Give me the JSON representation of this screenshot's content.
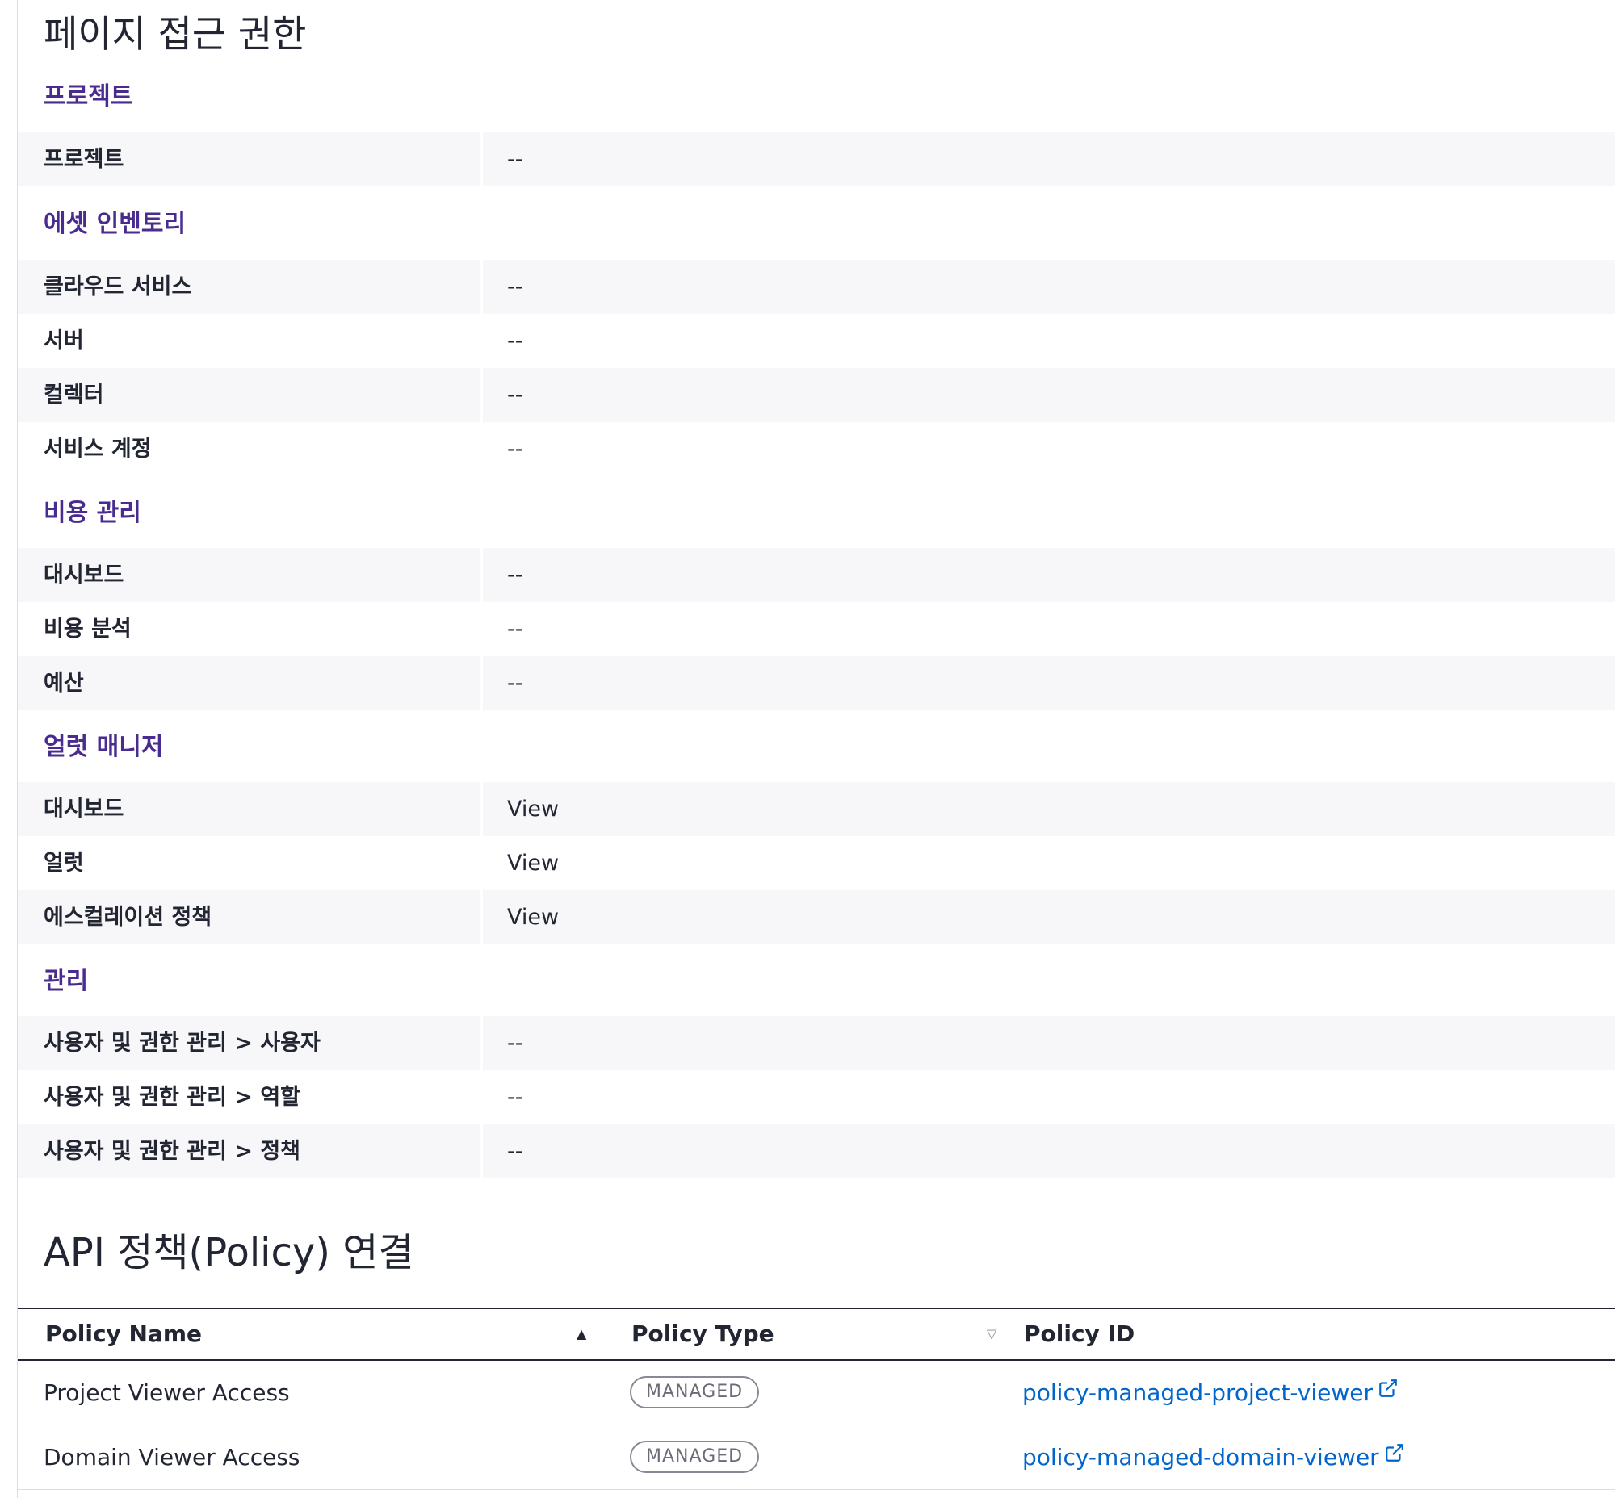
{
  "page_title": "페이지 접근 권한",
  "sections": [
    {
      "title": "프로젝트",
      "rows": [
        {
          "label": "프로젝트",
          "value": "--"
        }
      ]
    },
    {
      "title": "에셋 인벤토리",
      "rows": [
        {
          "label": "클라우드 서비스",
          "value": "--"
        },
        {
          "label": "서버",
          "value": "--"
        },
        {
          "label": "컬렉터",
          "value": "--"
        },
        {
          "label": "서비스 계정",
          "value": "--"
        }
      ]
    },
    {
      "title": "비용 관리",
      "rows": [
        {
          "label": "대시보드",
          "value": "--"
        },
        {
          "label": "비용 분석",
          "value": "--"
        },
        {
          "label": "예산",
          "value": "--"
        }
      ]
    },
    {
      "title": "얼럿 매니저",
      "rows": [
        {
          "label": "대시보드",
          "value": "View"
        },
        {
          "label": "얼럿",
          "value": "View"
        },
        {
          "label": "에스컬레이션 정책",
          "value": "View"
        }
      ]
    },
    {
      "title": "관리",
      "rows": [
        {
          "label": "사용자 및 권한 관리 > 사용자",
          "value": "--"
        },
        {
          "label": "사용자 및 권한 관리 > 역할",
          "value": "--"
        },
        {
          "label": "사용자 및 권한 관리 > 정책",
          "value": "--"
        }
      ]
    }
  ],
  "api_policy": {
    "title": "API 정책(Policy) 연결",
    "columns": [
      {
        "label": "Policy Name",
        "sort": "asc",
        "sort_icon": "triangle-up-icon"
      },
      {
        "label": "Policy Type",
        "sort": "none",
        "sort_icon": "triangle-down-outline-icon"
      },
      {
        "label": "Policy ID"
      }
    ],
    "rows": [
      {
        "name": "Project Viewer Access",
        "type": "MANAGED",
        "id": "policy-managed-project-viewer"
      },
      {
        "name": "Domain Viewer Access",
        "type": "MANAGED",
        "id": "policy-managed-domain-viewer"
      }
    ]
  },
  "colors": {
    "section_title": "#4a2b8f",
    "row_shade": "#f7f7f9",
    "link": "#0066cc",
    "badge_border": "#898995",
    "text": "#222532"
  }
}
